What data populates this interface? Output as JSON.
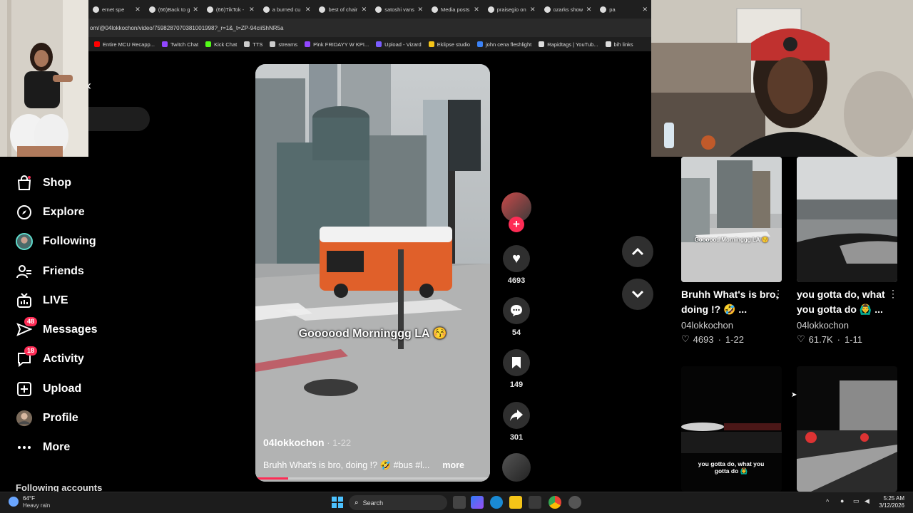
{
  "browser": {
    "tabs": [
      {
        "label": "ernet spe",
        "icon": "tab-icon"
      },
      {
        "label": "(66)Back to g",
        "icon": "tiktok-icon"
      },
      {
        "label": "(66)TikTok -",
        "icon": "tiktok-icon"
      },
      {
        "label": "a burned cu",
        "icon": "google-icon"
      },
      {
        "label": "best of chair",
        "icon": "x-icon"
      },
      {
        "label": "satoshi vans",
        "icon": "google-icon"
      },
      {
        "label": "Media posts",
        "icon": "x-icon"
      },
      {
        "label": "praisegio on",
        "icon": "x-icon"
      },
      {
        "label": "ozarks show",
        "icon": "google-icon"
      },
      {
        "label": "pa",
        "icon": "google-icon"
      }
    ],
    "address": "om/@04lokkochon/video/7598287070381001998?_r=1&_t=ZP-94ciiShNR5a",
    "bookmarks": [
      {
        "label": "Entire MCU Recapp...",
        "color": "#ff0000"
      },
      {
        "label": "Twitch Chat",
        "color": "#9146ff"
      },
      {
        "label": "Kick Chat",
        "color": "#53fc18"
      },
      {
        "label": "TTS",
        "color": "#cccccc"
      },
      {
        "label": "streams",
        "color": "#cccccc"
      },
      {
        "label": "Pink FRIDAYY W KPI...",
        "color": "#9146ff"
      },
      {
        "label": "Upload - Vizard",
        "color": "#7a5cff"
      },
      {
        "label": "Eklipse studio",
        "color": "#f5c518"
      },
      {
        "label": "john cena fleshlight",
        "color": "#3b82f6"
      },
      {
        "label": "Rapidtags | YouTub...",
        "color": "#dddddd"
      },
      {
        "label": "bih links",
        "color": "#dddddd"
      }
    ]
  },
  "sidebar": {
    "items": [
      {
        "label": "Shop",
        "icon": "shop-icon"
      },
      {
        "label": "Explore",
        "icon": "explore-icon"
      },
      {
        "label": "Following",
        "icon": "following-avatar-icon"
      },
      {
        "label": "Friends",
        "icon": "friends-icon"
      },
      {
        "label": "LIVE",
        "icon": "live-icon"
      },
      {
        "label": "Messages",
        "icon": "messages-icon",
        "badge": "48"
      },
      {
        "label": "Activity",
        "icon": "activity-icon",
        "badge": "18"
      },
      {
        "label": "Upload",
        "icon": "upload-icon"
      },
      {
        "label": "Profile",
        "icon": "profile-avatar-icon"
      },
      {
        "label": "More",
        "icon": "more-icon"
      }
    ],
    "following_accounts": "Following accounts"
  },
  "video": {
    "overlay_text": "Goooood Morninggg LA 😚",
    "author": "04lokkochon",
    "date": " · 1-22",
    "description": "Bruhh What's is bro, doing !? 🤣 #bus #l...",
    "more": "more",
    "progress": 0.14
  },
  "actions": {
    "likes": "4693",
    "comments": "54",
    "saves": "149",
    "shares": "301"
  },
  "grid": [
    {
      "overlay": "Goooood Morninggg LA 😚",
      "title": "Bruhh What's is bro, doing !? 🤣 ...",
      "author": "04lokkochon",
      "likes": "4693",
      "date": "1-22"
    },
    {
      "overlay": "",
      "title": "you gotta do, what you gotta do 🙆‍♂️ ...",
      "author": "04lokkochon",
      "likes": "61.7K",
      "date": "1-11"
    },
    {
      "overlay": "you gotta do, what you gotta do 🙆‍♂️"
    },
    {
      "overlay": ""
    }
  ],
  "taskbar": {
    "weather_temp": "64°F",
    "weather_desc": "Heavy rain",
    "search": "Search",
    "time": "5:25 AM",
    "date": "3/12/2026"
  },
  "colors": {
    "accent": "#fe2c55",
    "background": "#000000"
  }
}
